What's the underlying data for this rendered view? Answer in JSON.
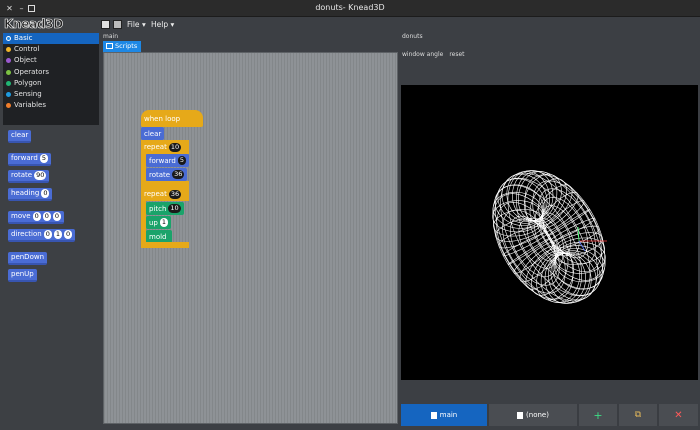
{
  "window": {
    "title": "donuts- Knead3D",
    "ghost_left": "/brew/dump/dummy",
    "ghost_right": "/brew/dump/dummy"
  },
  "app": {
    "logo": "Knead3D"
  },
  "palette": {
    "categories": [
      {
        "label": "Basic",
        "color": "#1565c0",
        "selected": true
      },
      {
        "label": "Control",
        "color": "#f0b429"
      },
      {
        "label": "Object",
        "color": "#9b59d0"
      },
      {
        "label": "Operators",
        "color": "#7cc242"
      },
      {
        "label": "Polygon",
        "color": "#21b573"
      },
      {
        "label": "Sensing",
        "color": "#1e9be0"
      },
      {
        "label": "Variables",
        "color": "#f07d2a"
      }
    ],
    "blocks": {
      "clear": "clear",
      "forward": {
        "label": "forward",
        "value": "5"
      },
      "rotate": {
        "label": "rotate",
        "value": "90"
      },
      "heading": {
        "label": "heading",
        "value": "0"
      },
      "move": {
        "label": "move",
        "values": [
          "0",
          "0",
          "0"
        ]
      },
      "direction": {
        "label": "direction",
        "values": [
          "0",
          "1",
          "0"
        ]
      },
      "penDown": "penDown",
      "penUp": "penUp"
    }
  },
  "toolbar": {
    "file": "File",
    "help": "Help"
  },
  "breadcrumb": "main",
  "scripts_tab": "Scripts",
  "script": {
    "hat": "when loop",
    "clear": "clear",
    "repeat1": {
      "label": "repeat",
      "value": "10"
    },
    "forward": {
      "label": "forward",
      "value": "5"
    },
    "rotate": {
      "label": "rotate",
      "value": "36"
    },
    "repeat2": {
      "label": "repeat",
      "value": "36"
    },
    "pitch": {
      "label": "pitch",
      "value": "10"
    },
    "up": {
      "label": "up",
      "value": "1"
    },
    "mold": "mold"
  },
  "stage": {
    "title": "donuts",
    "options": [
      "window angle",
      "reset"
    ]
  },
  "bottom": {
    "main_tab": "main",
    "none_tab": "(none)",
    "add_icon": "plus-icon",
    "duplicate_icon": "copy-icon",
    "delete_icon": "close-icon"
  }
}
